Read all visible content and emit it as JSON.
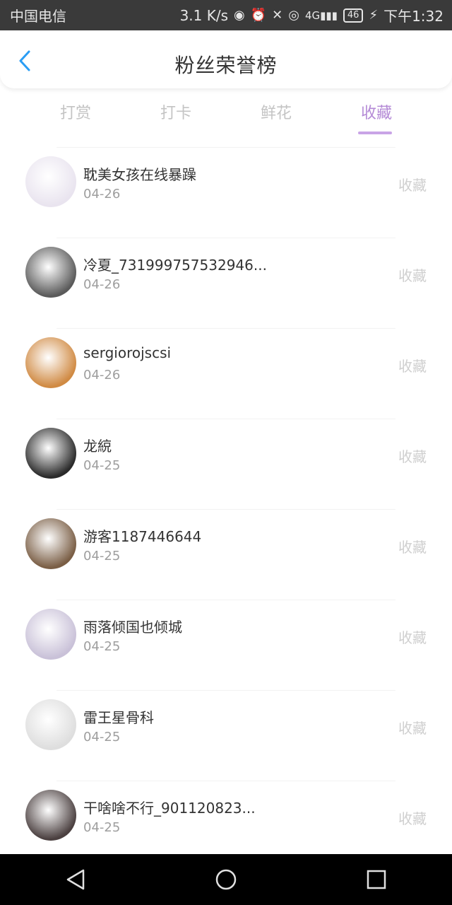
{
  "status_bar": {
    "carrier": "中国电信",
    "speed": "3.1 K/s",
    "network": "4G",
    "battery": "46",
    "time": "下午1:32"
  },
  "header": {
    "title": "粉丝荣誉榜"
  },
  "tabs": [
    {
      "label": "打赏",
      "active": false
    },
    {
      "label": "打卡",
      "active": false
    },
    {
      "label": "鲜花",
      "active": false
    },
    {
      "label": "收藏",
      "active": true
    }
  ],
  "list": {
    "action_label": "收藏",
    "items": [
      {
        "name": "耽美女孩在线暴躁",
        "date": "04-26",
        "avatar_color": "#e9e4ef"
      },
      {
        "name": "冷夏_731999757532946...",
        "date": "04-26",
        "avatar_color": "#5a5a5a"
      },
      {
        "name": "sergiorojscsi",
        "date": "04-26",
        "avatar_color": "#d08a43"
      },
      {
        "name": "龙綂",
        "date": "04-25",
        "avatar_color": "#2a2a2a"
      },
      {
        "name": "游客1187446644",
        "date": "04-25",
        "avatar_color": "#7a5e45"
      },
      {
        "name": "雨落倾国也倾城",
        "date": "04-25",
        "avatar_color": "#c9c1d8"
      },
      {
        "name": "雷王星骨科",
        "date": "04-25",
        "avatar_color": "#dedede"
      },
      {
        "name": "干啥啥不行_901120823...",
        "date": "04-25",
        "avatar_color": "#4b4040"
      }
    ]
  }
}
